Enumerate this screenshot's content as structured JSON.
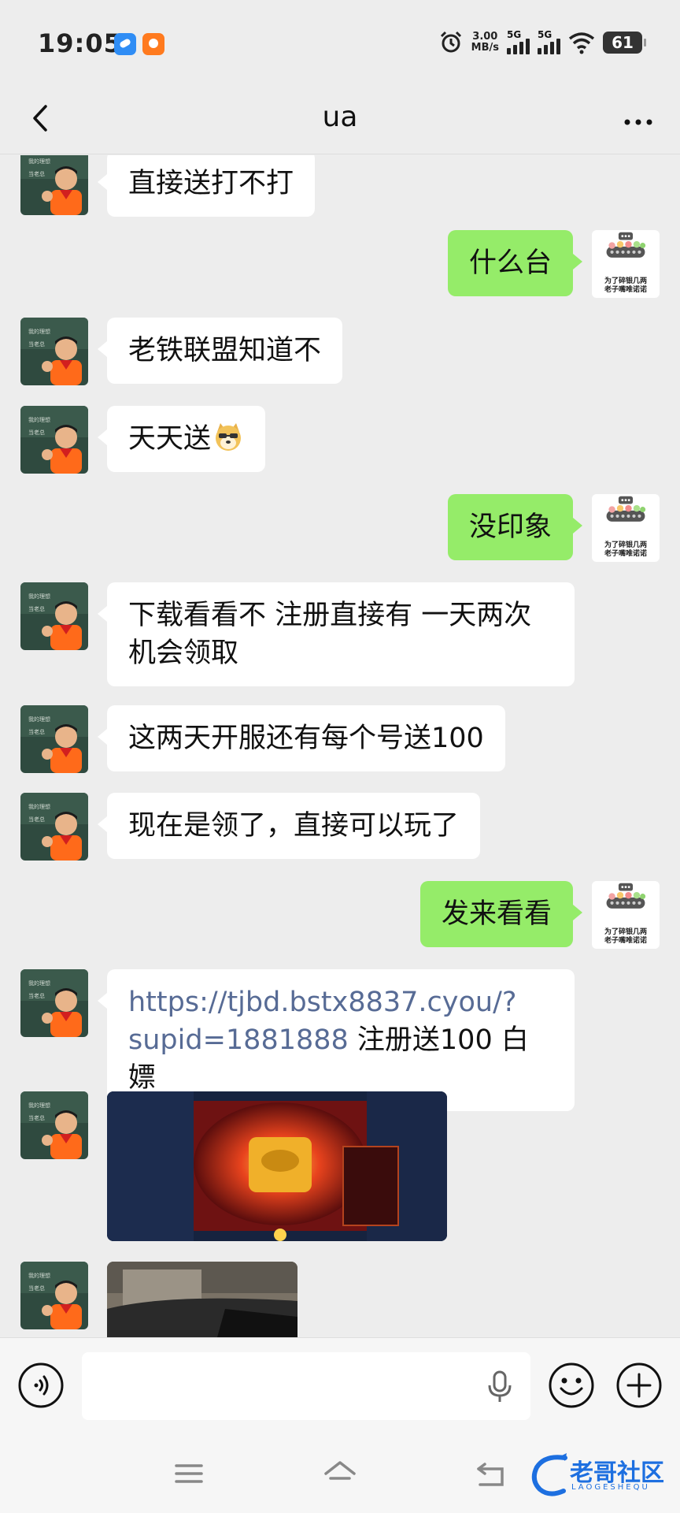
{
  "status": {
    "time": "19:05",
    "speed_value": "3.00",
    "speed_unit": "MB/s",
    "net1": "5G",
    "net2": "5G",
    "battery": "61"
  },
  "header": {
    "title": "ua"
  },
  "messages": [
    {
      "side": "in",
      "text": "直接送打不打"
    },
    {
      "side": "out",
      "text": "什么台"
    },
    {
      "side": "in",
      "text": "老铁联盟知道不"
    },
    {
      "side": "in",
      "text": "天天送"
    },
    {
      "side": "out",
      "text": "没印象"
    },
    {
      "side": "in",
      "text_line1": "下载看看不 注册直接有 一天两次",
      "text_line2": "机会领取"
    },
    {
      "side": "in",
      "text": "这两天开服还有每个号送100"
    },
    {
      "side": "in",
      "text": "现在是领了，直接可以玩了"
    },
    {
      "side": "out",
      "text": "发来看看"
    },
    {
      "side": "in",
      "link_line1": "https://tjbd.bstx8837.cyou/?",
      "link_line2": "supid=1881888",
      "suffix": " 注册送100 白嫖"
    },
    {
      "side": "in",
      "type": "image"
    },
    {
      "side": "in",
      "type": "image"
    }
  ],
  "sticker_avatar_text": {
    "line1": "为了碎银几两",
    "line2": "老子嘴唯诺诺"
  },
  "watermark": {
    "text": "老哥社区",
    "sub": "LAOGESHEQU"
  },
  "colors": {
    "bubble_out": "#95ec69",
    "bubble_in": "#ffffff",
    "background": "#ededed",
    "link": "#576b95"
  },
  "icons": [
    "back-arrow-icon",
    "more-dots-icon",
    "voice-icon",
    "mic-icon",
    "emoji-icon",
    "plus-icon",
    "menu-icon",
    "home-icon",
    "back-icon"
  ]
}
